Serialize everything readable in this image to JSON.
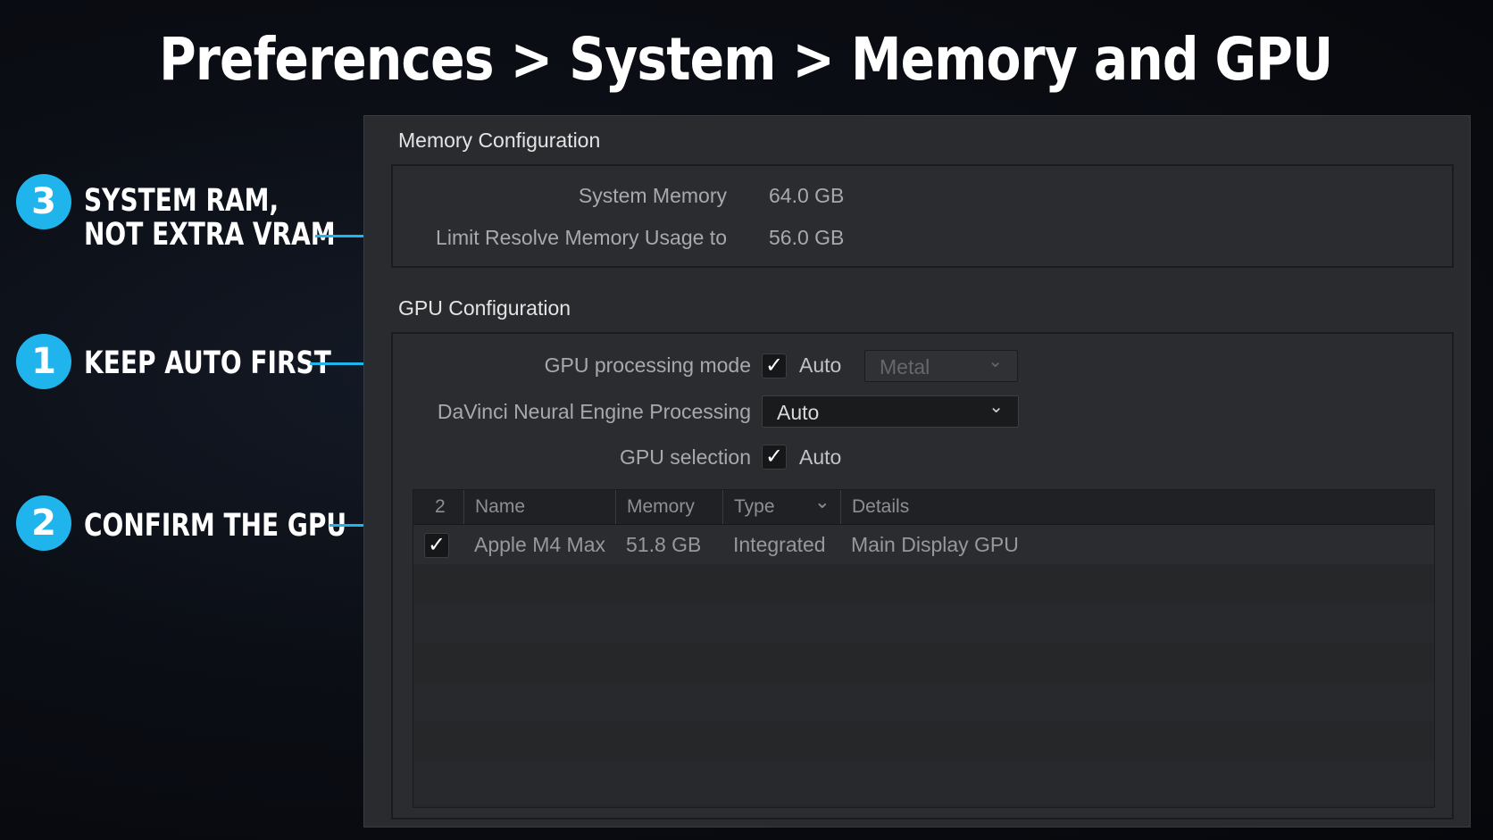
{
  "page_title": "Preferences > System > Memory and GPU",
  "callouts": [
    {
      "number": "3",
      "lines": [
        "SYSTEM RAM,",
        "NOT EXTRA VRAM"
      ]
    },
    {
      "number": "1",
      "lines": [
        "KEEP AUTO FIRST"
      ]
    },
    {
      "number": "2",
      "lines": [
        "CONFIRM THE GPU"
      ]
    }
  ],
  "memory": {
    "section_title": "Memory Configuration",
    "system_memory_label": "System Memory",
    "system_memory_value": "64.0 GB",
    "limit_label": "Limit Resolve Memory Usage to",
    "limit_value": "56.0 GB"
  },
  "gpu": {
    "section_title": "GPU Configuration",
    "processing_mode_label": "GPU processing mode",
    "processing_mode_auto_checked": true,
    "processing_mode_auto_label": "Auto",
    "processing_mode_dropdown": "Metal",
    "neural_engine_label": "DaVinci Neural Engine Processing",
    "neural_engine_dropdown": "Auto",
    "selection_label": "GPU selection",
    "selection_auto_checked": true,
    "selection_auto_label": "Auto",
    "table": {
      "columns": [
        "2",
        "Name",
        "Memory",
        "Type",
        "Details"
      ],
      "rows": [
        {
          "checked": true,
          "name": "Apple M4 Max",
          "memory": "51.8 GB",
          "type": "Integrated",
          "details": "Main Display GPU"
        }
      ]
    }
  },
  "icons": {
    "check": "✓",
    "chevron": "⌄"
  },
  "colors": {
    "accent": "#1fb5ec",
    "panel_bg": "#2a2b2e",
    "background": "#0b0e15"
  }
}
